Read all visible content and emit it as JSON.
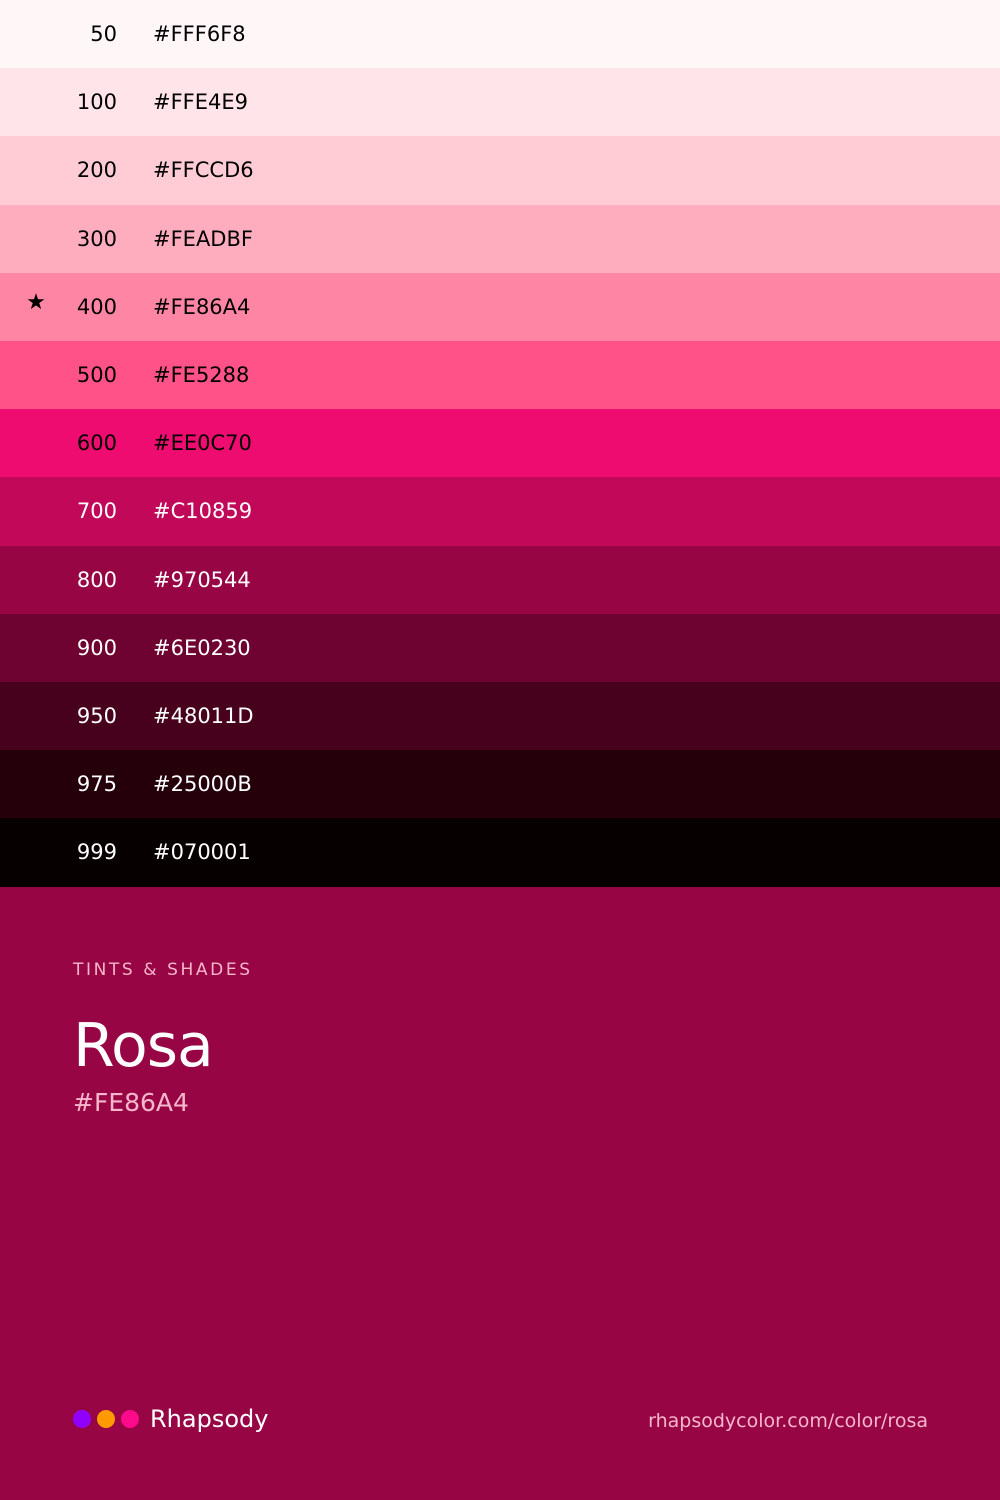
{
  "swatches": [
    {
      "step": "50",
      "hex": "#FFF6F8",
      "text_color": "#000000",
      "starred": false
    },
    {
      "step": "100",
      "hex": "#FFE4E9",
      "text_color": "#000000",
      "starred": false
    },
    {
      "step": "200",
      "hex": "#FFCCD6",
      "text_color": "#000000",
      "starred": false
    },
    {
      "step": "300",
      "hex": "#FEADBF",
      "text_color": "#000000",
      "starred": false
    },
    {
      "step": "400",
      "hex": "#FE86A4",
      "text_color": "#000000",
      "starred": true
    },
    {
      "step": "500",
      "hex": "#FE5288",
      "text_color": "#000000",
      "starred": false
    },
    {
      "step": "600",
      "hex": "#EE0C70",
      "text_color": "#000000",
      "starred": false
    },
    {
      "step": "700",
      "hex": "#C10859",
      "text_color": "#FFFFFF",
      "starred": false
    },
    {
      "step": "800",
      "hex": "#970544",
      "text_color": "#FFFFFF",
      "starred": false
    },
    {
      "step": "900",
      "hex": "#6E0230",
      "text_color": "#FFFFFF",
      "starred": false
    },
    {
      "step": "950",
      "hex": "#48011D",
      "text_color": "#FFFFFF",
      "starred": false
    },
    {
      "step": "975",
      "hex": "#25000B",
      "text_color": "#FFFFFF",
      "starred": false
    },
    {
      "step": "999",
      "hex": "#070001",
      "text_color": "#FFFFFF",
      "starred": false
    }
  ],
  "star_icon": "star-icon",
  "star_glyph": "★",
  "info": {
    "eyebrow": "TINTS & SHADES",
    "color_name": "Rosa",
    "color_hex": "#FE86A4"
  },
  "footer": {
    "brand_name": "Rhapsody",
    "brand_dots": [
      "#8F00FF",
      "#FF9900",
      "#FF0A8A"
    ],
    "url": "rhapsodycolor.com/color/rosa"
  },
  "colors": {
    "background": "#970544",
    "muted_text": "#F7B6CC",
    "title_text": "#FFFFFF"
  }
}
